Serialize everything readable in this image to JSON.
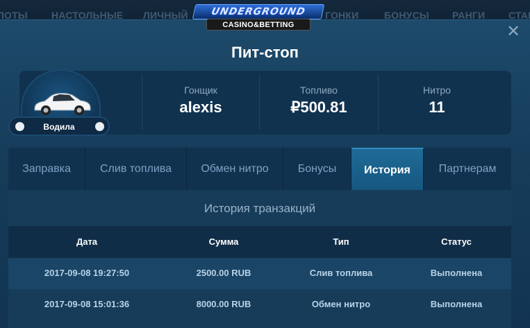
{
  "nav": {
    "items": [
      "ЛОТЫ",
      "НАСТОЛЬНЫЕ",
      "ЛИЧНЫЙ",
      "ГОНКИ",
      "БОНУСЫ",
      "РАНГИ",
      "СТАВ"
    ]
  },
  "logo": {
    "top_text": "UNDERGROUND",
    "bottom_text": "CASINO&BETTING"
  },
  "modal": {
    "title": "Пит-стоп",
    "close_glyph": "✕"
  },
  "driver": {
    "label": "Водила"
  },
  "stats": {
    "racer_label": "Гонщик",
    "racer_value": "alexis",
    "fuel_label": "Топливо",
    "fuel_value": "₽500.81",
    "nitro_label": "Нитро",
    "nitro_value": "11"
  },
  "tabs": [
    {
      "label": "Заправка"
    },
    {
      "label": "Слив топлива"
    },
    {
      "label": "Обмен нитро"
    },
    {
      "label": "Бонусы"
    },
    {
      "label": "История",
      "active": true
    },
    {
      "label": "Партнерам"
    }
  ],
  "history": {
    "title": "История транзакций",
    "columns": [
      "Дата",
      "Сумма",
      "Тип",
      "Статус"
    ],
    "rows": [
      [
        "2017-09-08 19:27:50",
        "2500.00 RUB",
        "Слив топлива",
        "Выполнена"
      ],
      [
        "2017-09-08 15:01:36",
        "8000.00 RUB",
        "Обмен нитро",
        "Выполнена"
      ]
    ]
  },
  "colors": {
    "accent": "#1f6b98",
    "background": "#163c5a",
    "text_muted": "#8fa9bf"
  }
}
